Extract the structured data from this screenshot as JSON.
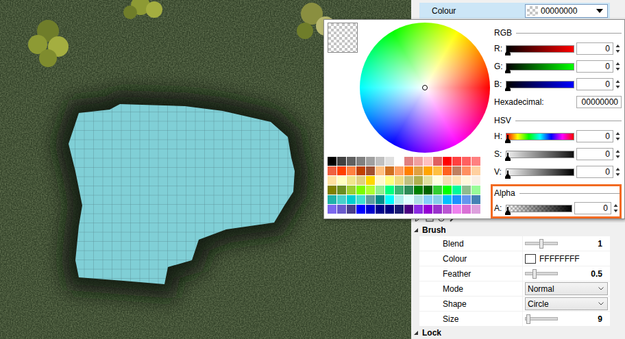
{
  "property_grid": {
    "selected_row": {
      "label": "Colour",
      "value": "00000000",
      "selected": true
    },
    "groups": [
      {
        "title": "Brush",
        "expanded": true,
        "rows": [
          {
            "kind": "slider",
            "label": "Blend",
            "value": "1",
            "level": 0.5
          },
          {
            "kind": "colour",
            "label": "Colour",
            "value": "FFFFFFFF"
          },
          {
            "kind": "slider",
            "label": "Feather",
            "value": "0.5",
            "level": 0.3
          },
          {
            "kind": "dropdown",
            "label": "Mode",
            "value": "Normal"
          },
          {
            "kind": "dropdown",
            "label": "Shape",
            "value": "Circle"
          },
          {
            "kind": "slider",
            "label": "Size",
            "value": "9",
            "level": 0.1
          }
        ]
      },
      {
        "title": "Lock",
        "expanded": true,
        "rows": []
      }
    ]
  },
  "color_picker": {
    "palette": [
      "#000000",
      "#404040",
      "#606060",
      "#808080",
      "#a0a0a0",
      "#c0c0c0",
      "#e0e0e0",
      "#ffffff",
      "#e08080",
      "#f0a0a0",
      "#ffc0c0",
      "#e06060",
      "#ff0000",
      "#ff4040",
      "#ff6060",
      "#ff8080",
      "#f06040",
      "#ff4000",
      "#ff8040",
      "#c04000",
      "#a05030",
      "#ffc080",
      "#d07020",
      "#ffa060",
      "#ff8000",
      "#e0a040",
      "#ffa500",
      "#ffc040",
      "#ff6020",
      "#c08060",
      "#ff9060",
      "#ffd0a0",
      "#ffe0a0",
      "#ffffc0",
      "#f0e68c",
      "#e0d080",
      "#ffd700",
      "#fffacd",
      "#ffff80",
      "#eedd82",
      "#c0c080",
      "#b0b050",
      "#e0e0a0",
      "#ffffe0",
      "#f5deb3",
      "#ffe4b5",
      "#fff8dc",
      "#faf0e6",
      "#808000",
      "#6b8e23",
      "#9acd32",
      "#7cfc00",
      "#adff2f",
      "#90ee90",
      "#00ff7f",
      "#3cb371",
      "#2e8b57",
      "#008000",
      "#006400",
      "#32cd32",
      "#00ff00",
      "#00fa9a",
      "#8fbc8f",
      "#98fb98",
      "#20b2aa",
      "#48d1cc",
      "#00ced1",
      "#40e0d0",
      "#5f9ea0",
      "#008b8b",
      "#00ffff",
      "#afeeee",
      "#e0ffff",
      "#b0e0e6",
      "#87cefa",
      "#87ceeb",
      "#00bfff",
      "#1e90ff",
      "#6495ed",
      "#4682b4",
      "#7b68ee",
      "#6a5acd",
      "#483d8b",
      "#0000ff",
      "#0000cd",
      "#00008b",
      "#000080",
      "#191970",
      "#4b0082",
      "#8a2be2",
      "#9400d3",
      "#9932cc",
      "#ba55d3",
      "#ee82ee",
      "#da70d6",
      "#dda0dd"
    ],
    "sections": [
      {
        "title": "RGB",
        "highlighted": false,
        "rows": [
          {
            "kind": "red",
            "label": "R:",
            "level": 0,
            "value": "0"
          },
          {
            "kind": "green",
            "label": "G:",
            "level": 0,
            "value": "0"
          },
          {
            "kind": "blue",
            "label": "B:",
            "level": 0,
            "value": "0"
          },
          {
            "kind": "field",
            "label": "Hexadecimal:",
            "value": "00000000"
          }
        ]
      },
      {
        "title": "HSV",
        "highlighted": false,
        "rows": [
          {
            "kind": "hue",
            "label": "H:",
            "level": 0,
            "value": "0"
          },
          {
            "kind": "saturation",
            "label": "S:",
            "level": 0,
            "value": "0"
          },
          {
            "kind": "value",
            "label": "V:",
            "level": 0,
            "value": "0"
          }
        ]
      },
      {
        "title": "Alpha",
        "highlighted": true,
        "rows": [
          {
            "kind": "alpha",
            "label": "A:",
            "level": 0,
            "value": "0"
          }
        ]
      }
    ]
  }
}
